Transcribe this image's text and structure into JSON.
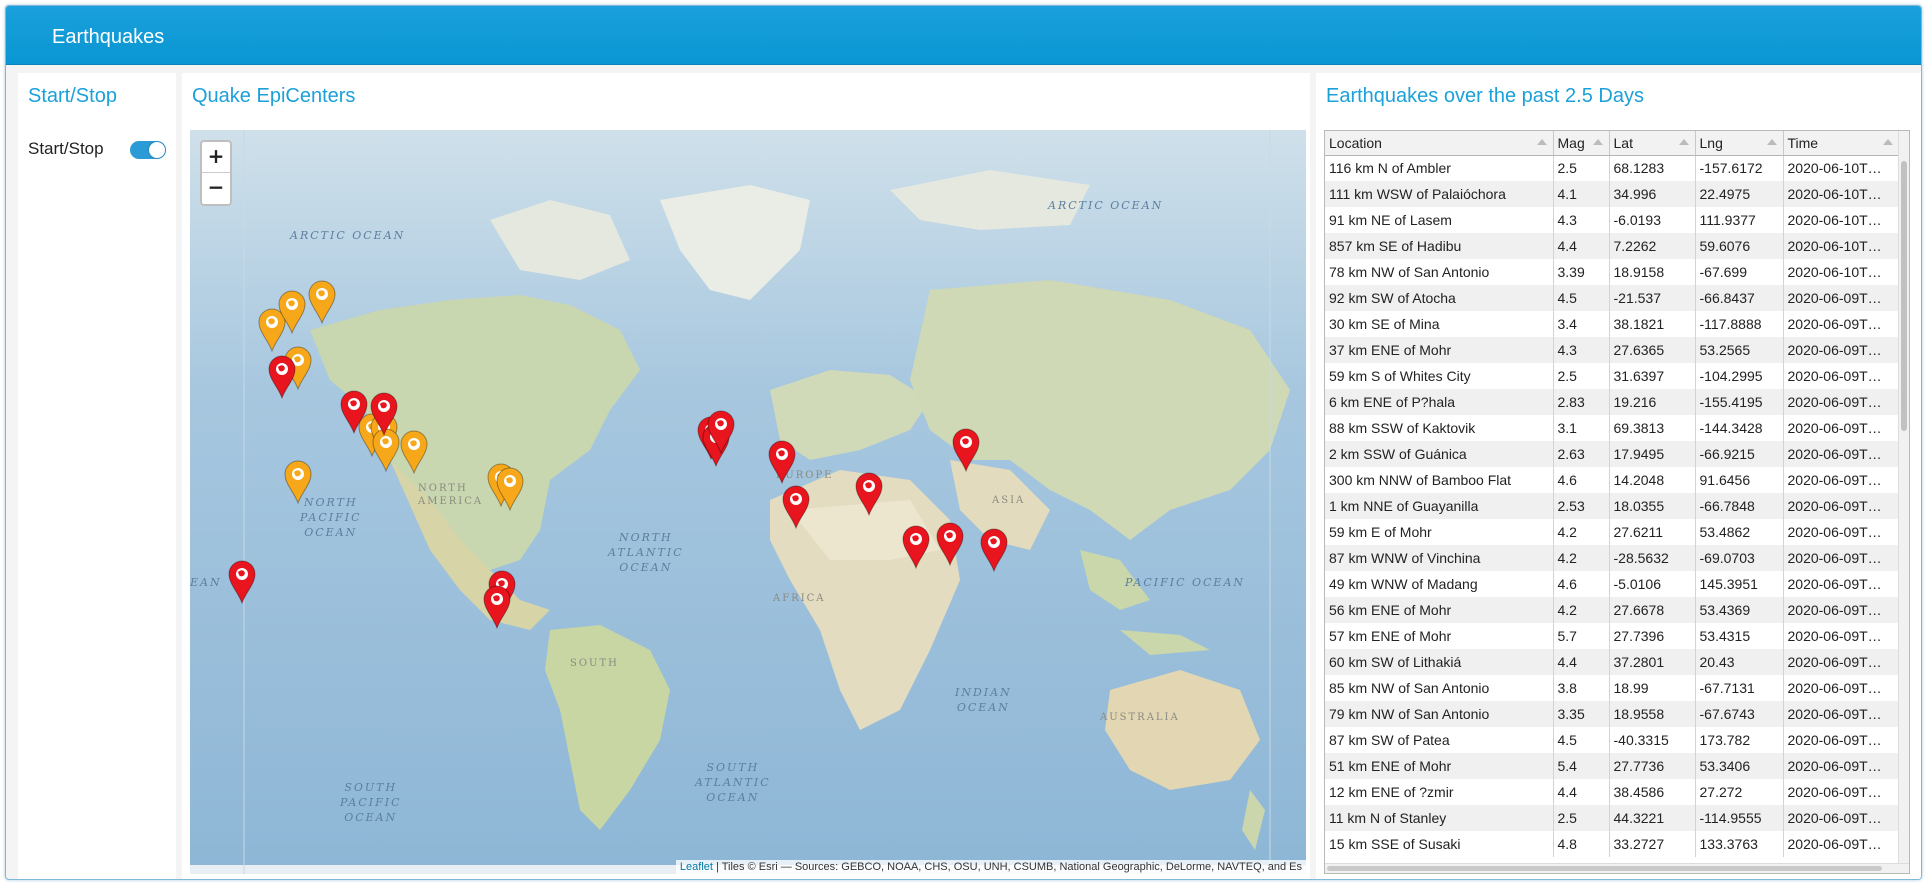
{
  "app": {
    "title": "Earthquakes"
  },
  "colors": {
    "header": "#0996d2",
    "accent": "#1ba1d9",
    "marker_red": "#e8141e",
    "marker_orange": "#f6a81a"
  },
  "startstop": {
    "title": "Start/Stop",
    "toggle_label": "Start/Stop",
    "toggle_on": true
  },
  "map": {
    "title": "Quake EpiCenters",
    "zoom_in": "+",
    "zoom_out": "−",
    "attribution_link": "Leaflet",
    "attribution_text": " | Tiles © Esri — Sources: GEBCO, NOAA, CHS, OSU, UNH, CSUMB, National Geographic, DeLorme, NAVTEQ, and Es",
    "labels": {
      "arctic_left": "ARCTIC OCEAN",
      "arctic_right": "ARCTIC OCEAN",
      "north_pacific": "NORTH\nPACIFIC\nOCEAN",
      "north_atlantic": "NORTH\nATLANTIC\nOCEAN",
      "pacific_right": "PACIFIC OCEAN",
      "indian": "INDIAN\nOCEAN",
      "south_atlantic": "SOUTH\nATLANTIC\nOCEAN",
      "south_pacific": "SOUTH\nPACIFIC\nOCEAN",
      "africa": "AFRICA",
      "asia": "ASIA",
      "europe": "EUROPE",
      "australia": "AUSTRALIA",
      "south_america": "SOUTH",
      "north_america": "NORTH\nAMERICA",
      "ean_fragment": "EAN"
    },
    "markers": [
      {
        "color": "orange",
        "icon": "earth-icon"
      },
      {
        "color": "orange",
        "icon": "earth-icon"
      },
      {
        "color": "orange",
        "icon": "earth-icon"
      },
      {
        "color": "orange",
        "icon": "earth-icon"
      },
      {
        "color": "red",
        "icon": "earth-icon"
      },
      {
        "color": "red",
        "icon": "earth-icon"
      },
      {
        "color": "orange",
        "icon": "earth-icon"
      },
      {
        "color": "orange",
        "icon": "earth-icon"
      },
      {
        "color": "orange",
        "icon": "earth-icon"
      },
      {
        "color": "orange",
        "icon": "earth-icon"
      },
      {
        "color": "orange",
        "icon": "earth-icon"
      },
      {
        "color": "orange",
        "icon": "earth-icon"
      },
      {
        "color": "orange",
        "icon": "earth-icon"
      },
      {
        "color": "red",
        "icon": "earth-icon"
      },
      {
        "color": "red",
        "icon": "earth-icon"
      },
      {
        "color": "red",
        "icon": "earth-icon"
      },
      {
        "color": "red",
        "icon": "earth-icon"
      },
      {
        "color": "red",
        "icon": "earth-icon"
      },
      {
        "color": "red",
        "icon": "earth-icon"
      },
      {
        "color": "red",
        "icon": "earth-icon"
      },
      {
        "color": "red",
        "icon": "earth-icon"
      },
      {
        "color": "red",
        "icon": "earth-icon"
      },
      {
        "color": "red",
        "icon": "earth-icon"
      },
      {
        "color": "red",
        "icon": "earth-icon"
      },
      {
        "color": "red",
        "icon": "earth-icon"
      },
      {
        "color": "red",
        "icon": "earth-icon"
      },
      {
        "color": "red",
        "icon": "earth-icon"
      }
    ]
  },
  "table": {
    "title": "Earthquakes over the past 2.5 Days",
    "columns": [
      "Location",
      "Mag",
      "Lat",
      "Lng",
      "Time"
    ],
    "rows": [
      [
        "116 km N of Ambler",
        "2.5",
        "68.1283",
        "-157.6172",
        "2020-06-10T…"
      ],
      [
        "111 km WSW of Palaióchora",
        "4.1",
        "34.996",
        "22.4975",
        "2020-06-10T…"
      ],
      [
        "91 km NE of Lasem",
        "4.3",
        "-6.0193",
        "111.9377",
        "2020-06-10T…"
      ],
      [
        "857 km SE of Hadibu",
        "4.4",
        "7.2262",
        "59.6076",
        "2020-06-10T…"
      ],
      [
        "78 km NW of San Antonio",
        "3.39",
        "18.9158",
        "-67.699",
        "2020-06-10T…"
      ],
      [
        "92 km SW of Atocha",
        "4.5",
        "-21.537",
        "-66.8437",
        "2020-06-09T…"
      ],
      [
        "30 km SE of Mina",
        "3.4",
        "38.1821",
        "-117.8888",
        "2020-06-09T…"
      ],
      [
        "37 km ENE of Mohr",
        "4.3",
        "27.6365",
        "53.2565",
        "2020-06-09T…"
      ],
      [
        "59 km S of Whites City",
        "2.5",
        "31.6397",
        "-104.2995",
        "2020-06-09T…"
      ],
      [
        "6 km ENE of P?hala",
        "2.83",
        "19.216",
        "-155.4195",
        "2020-06-09T…"
      ],
      [
        "88 km SSW of Kaktovik",
        "3.1",
        "69.3813",
        "-144.3428",
        "2020-06-09T…"
      ],
      [
        "2 km SSW of Guánica",
        "2.63",
        "17.9495",
        "-66.9215",
        "2020-06-09T…"
      ],
      [
        "300 km NNW of Bamboo Flat",
        "4.6",
        "14.2048",
        "91.6456",
        "2020-06-09T…"
      ],
      [
        "1 km NNE of Guayanilla",
        "2.53",
        "18.0355",
        "-66.7848",
        "2020-06-09T…"
      ],
      [
        "59 km E of Mohr",
        "4.2",
        "27.6211",
        "53.4862",
        "2020-06-09T…"
      ],
      [
        "87 km WNW of Vinchina",
        "4.2",
        "-28.5632",
        "-69.0703",
        "2020-06-09T…"
      ],
      [
        "49 km WNW of Madang",
        "4.6",
        "-5.0106",
        "145.3951",
        "2020-06-09T…"
      ],
      [
        "56 km ENE of Mohr",
        "4.2",
        "27.6678",
        "53.4369",
        "2020-06-09T…"
      ],
      [
        "57 km ENE of Mohr",
        "5.7",
        "27.7396",
        "53.4315",
        "2020-06-09T…"
      ],
      [
        "60 km SW of Lithakiá",
        "4.4",
        "37.2801",
        "20.43",
        "2020-06-09T…"
      ],
      [
        "85 km NW of San Antonio",
        "3.8",
        "18.99",
        "-67.7131",
        "2020-06-09T…"
      ],
      [
        "79 km NW of San Antonio",
        "3.35",
        "18.9558",
        "-67.6743",
        "2020-06-09T…"
      ],
      [
        "87 km SW of Patea",
        "4.5",
        "-40.3315",
        "173.782",
        "2020-06-09T…"
      ],
      [
        "51 km ENE of Mohr",
        "5.4",
        "27.7736",
        "53.3406",
        "2020-06-09T…"
      ],
      [
        "12 km ENE of ?zmir",
        "4.4",
        "38.4586",
        "27.272",
        "2020-06-09T…"
      ],
      [
        "11 km N of Stanley",
        "2.5",
        "44.3221",
        "-114.9555",
        "2020-06-09T…"
      ],
      [
        "15 km SSE of Susaki",
        "4.8",
        "33.2727",
        "133.3763",
        "2020-06-09T…"
      ]
    ]
  }
}
